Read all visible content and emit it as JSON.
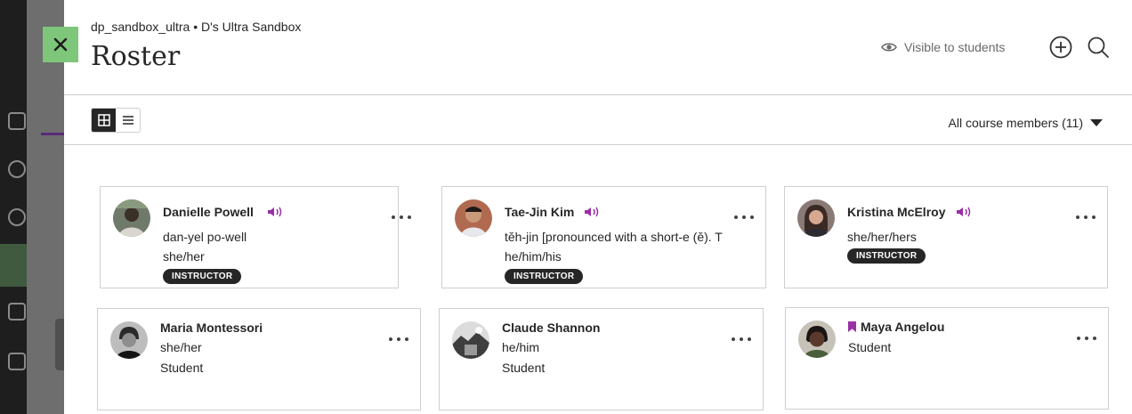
{
  "header": {
    "breadcrumb": "dp_sandbox_ultra • D's Ultra Sandbox",
    "title": "Roster",
    "visibility_label": "Visible to students"
  },
  "toolbar": {
    "filter_label": "All course members (11)"
  },
  "members": [
    {
      "name": "Danielle Powell",
      "pronunciation": "dan-yel po-well",
      "pronouns": "she/her",
      "badge": "INSTRUCTOR",
      "has_audio": true
    },
    {
      "name": "Tae-Jin Kim",
      "pronunciation": "tĕh-jin [pronounced with a short-e (ĕ). T",
      "pronouns": "he/him/his",
      "badge": "INSTRUCTOR",
      "has_audio": true
    },
    {
      "name": "Kristina McElroy",
      "pronouns": "she/her/hers",
      "badge": "INSTRUCTOR",
      "has_audio": true
    },
    {
      "name": "Maria Montessori",
      "pronouns": "she/her",
      "role": "Student"
    },
    {
      "name": "Claude Shannon",
      "pronouns": "he/him",
      "role": "Student"
    },
    {
      "name": "Maya Angelou",
      "role": "Student",
      "bookmarked": true
    }
  ],
  "colors": {
    "close_button": "#7ec67a",
    "audio_icon": "#9b2fa7",
    "badge_bg": "#262626"
  }
}
